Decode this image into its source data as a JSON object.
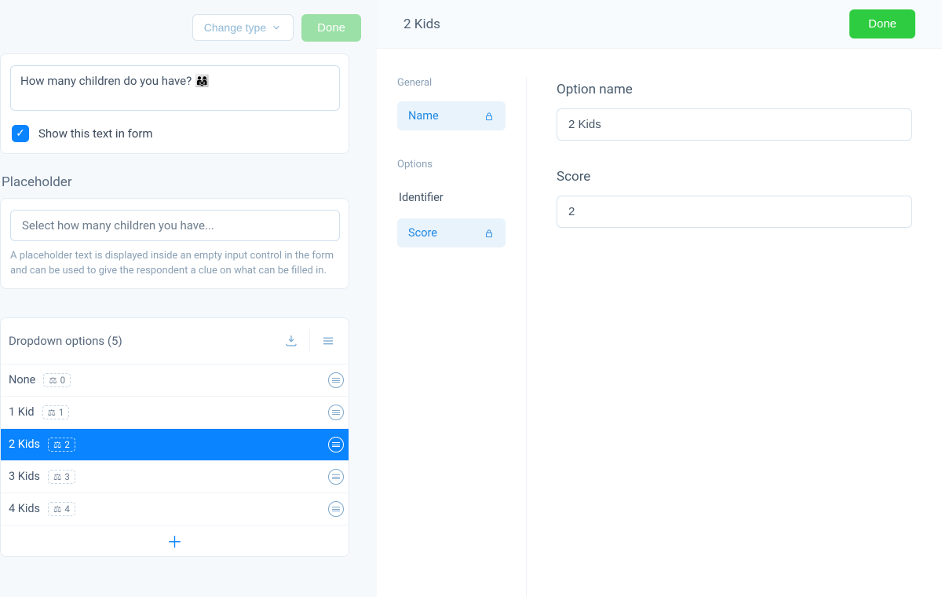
{
  "left": {
    "toolbar": {
      "change_type": "Change type",
      "done": "Done"
    },
    "question_text": "How many children do you have? 👨‍👩‍👧",
    "show_text_label": "Show this text in form",
    "show_text_checked": true,
    "placeholder_title": "Placeholder",
    "placeholder_value": "Select how many children you have...",
    "placeholder_hint": "A placeholder text is displayed inside an empty input control in the form and can be used to give the respondent a clue on what can be filled in.",
    "options_header": "Dropdown options (5)",
    "options": [
      {
        "label": "None",
        "score": "0",
        "selected": false
      },
      {
        "label": "1 Kid",
        "score": "1",
        "selected": false
      },
      {
        "label": "2 Kids",
        "score": "2",
        "selected": true
      },
      {
        "label": "3 Kids",
        "score": "3",
        "selected": false
      },
      {
        "label": "4 Kids",
        "score": "4",
        "selected": false
      }
    ]
  },
  "right": {
    "header_title": "2 Kids",
    "done": "Done",
    "nav": {
      "group1": "General",
      "name": "Name",
      "group2": "Options",
      "identifier": "Identifier",
      "score": "Score"
    },
    "fields": {
      "option_name_label": "Option name",
      "option_name_value": "2 Kids",
      "score_label": "Score",
      "score_value": "2"
    }
  }
}
